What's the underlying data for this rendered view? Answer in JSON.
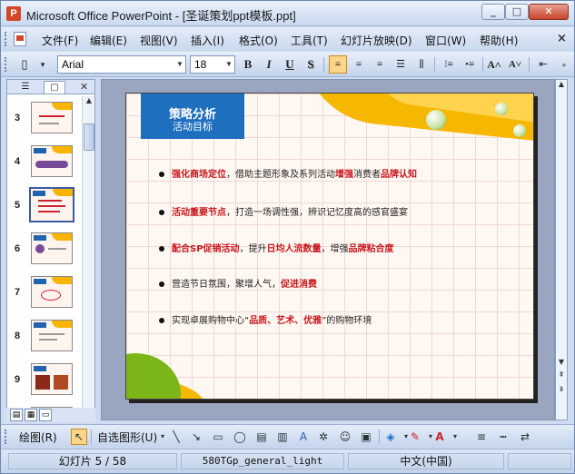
{
  "window": {
    "title": "Microsoft Office PowerPoint - [圣诞策划ppt模板.ppt]",
    "app_icon": "P",
    "controls": {
      "minimize": "_",
      "maximize": "□",
      "close": "✕"
    }
  },
  "menubar": {
    "items": [
      {
        "label": "文件(F)"
      },
      {
        "label": "编辑(E)"
      },
      {
        "label": "视图(V)"
      },
      {
        "label": "插入(I)"
      },
      {
        "label": "格式(O)"
      },
      {
        "label": "工具(T)"
      },
      {
        "label": "幻灯片放映(D)"
      },
      {
        "label": "窗口(W)"
      },
      {
        "label": "帮助(H)"
      }
    ],
    "close": "×"
  },
  "toolbar": {
    "font_name": "Arial",
    "font_size": "18",
    "bold": "B",
    "italic": "I",
    "underline": "U",
    "shadow": "S",
    "grow_font": "A˄",
    "shrink_font": "A˅"
  },
  "slide_pane": {
    "thumbnails": [
      {
        "number": "3"
      },
      {
        "number": "4"
      },
      {
        "number": "5",
        "selected": true
      },
      {
        "number": "6"
      },
      {
        "number": "7"
      },
      {
        "number": "8"
      },
      {
        "number": "9"
      }
    ]
  },
  "slide": {
    "title": "策略分析",
    "subtitle": "活动目标",
    "bullets": [
      {
        "parts": [
          {
            "text": "强化商场定位",
            "red": true
          },
          {
            "text": "，借助主题形象及系列活动",
            "red": false
          },
          {
            "text": "增强",
            "red": true
          },
          {
            "text": "消费者",
            "red": false
          },
          {
            "text": "品牌认知",
            "red": true
          }
        ]
      },
      {
        "parts": [
          {
            "text": "活动重要节点",
            "red": true
          },
          {
            "text": "，打造一场调性强，辨识记忆度高的感官盛宴",
            "red": false
          }
        ]
      },
      {
        "parts": [
          {
            "text": "配合SP促销活动",
            "red": true
          },
          {
            "text": "，提升",
            "red": false
          },
          {
            "text": "日均人流数量",
            "red": true
          },
          {
            "text": "，增强",
            "red": false
          },
          {
            "text": "品牌粘合度",
            "red": true
          }
        ]
      },
      {
        "parts": [
          {
            "text": "营造节日氛围，聚增人气，",
            "red": false
          },
          {
            "text": "促进消费",
            "red": true
          }
        ]
      },
      {
        "parts": [
          {
            "text": "实现卓展购物中心“",
            "red": false
          },
          {
            "text": "品质、艺术、优雅",
            "red": true
          },
          {
            "text": "”的购物环境",
            "red": false
          }
        ]
      }
    ]
  },
  "drawbar": {
    "draw_label": "绘图(R)",
    "autoshapes_label": "自选图形(U)"
  },
  "statusbar": {
    "slide_info": "幻灯片 5 / 58",
    "design": "580TGp_general_light",
    "language": "中文(中国)"
  }
}
